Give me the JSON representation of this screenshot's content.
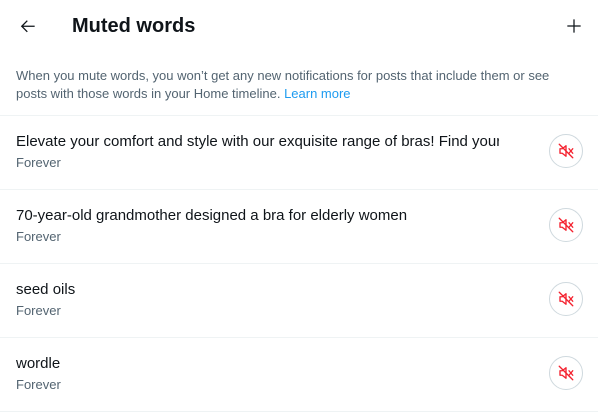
{
  "header": {
    "title": "Muted words",
    "back_icon": "arrow-left-icon",
    "add_icon": "plus-icon"
  },
  "description": {
    "text": "When you mute words, you won’t get any new notifications for posts that include them or see posts with those words in your Home timeline. ",
    "link": "Learn more"
  },
  "muted_words": [
    {
      "word": "Elevate your comfort and style with our exquisite range of bras! Find your",
      "duration": "Forever"
    },
    {
      "word": "70-year-old grandmother designed a bra for elderly women",
      "duration": "Forever"
    },
    {
      "word": "seed oils",
      "duration": "Forever"
    },
    {
      "word": "wordle",
      "duration": "Forever"
    }
  ],
  "colors": {
    "text_primary": "#0f1419",
    "text_secondary": "#536471",
    "link": "#1d9bf0",
    "unmute_icon": "#f4212e",
    "divider": "#eff3f4"
  },
  "unmute_icon": "speaker-muted-icon"
}
